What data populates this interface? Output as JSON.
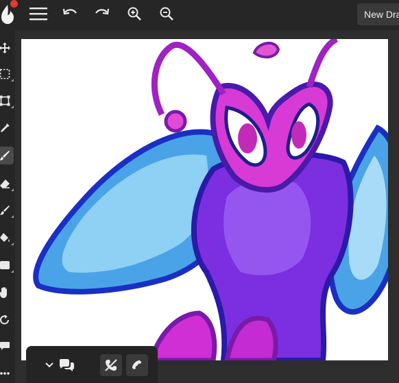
{
  "toolbar": {
    "new_drawing_label": "New Dra"
  },
  "icons": {
    "logo": "flame-logo-icon",
    "menu": "hamburger-menu-icon",
    "undo": "undo-icon",
    "redo": "redo-icon",
    "zoom_in": "zoom-in-icon",
    "zoom_out": "zoom-out-icon"
  },
  "tools": [
    {
      "name": "move-tool",
      "active": false
    },
    {
      "name": "select-tool",
      "active": false
    },
    {
      "name": "transform-tool",
      "active": false
    },
    {
      "name": "eyedropper-tool",
      "active": false
    },
    {
      "name": "brush-tool",
      "active": true
    },
    {
      "name": "eraser-tool",
      "active": false
    },
    {
      "name": "smudge-tool",
      "active": false
    },
    {
      "name": "fill-tool",
      "active": false
    },
    {
      "name": "shape-tool",
      "active": false
    },
    {
      "name": "hand-tool",
      "active": false
    },
    {
      "name": "rotate-tool",
      "active": false
    },
    {
      "name": "comment-tool",
      "active": false
    },
    {
      "name": "more-tools",
      "active": false
    }
  ],
  "chat": {
    "icons": [
      "chevron-down-icon",
      "chat-bubbles-icon",
      "mute-voice-icon",
      "phone-icon"
    ]
  },
  "colors": {
    "accent_notification": "#e53935",
    "ui_dark": "#262626",
    "canvas_bg": "#ffffff"
  }
}
